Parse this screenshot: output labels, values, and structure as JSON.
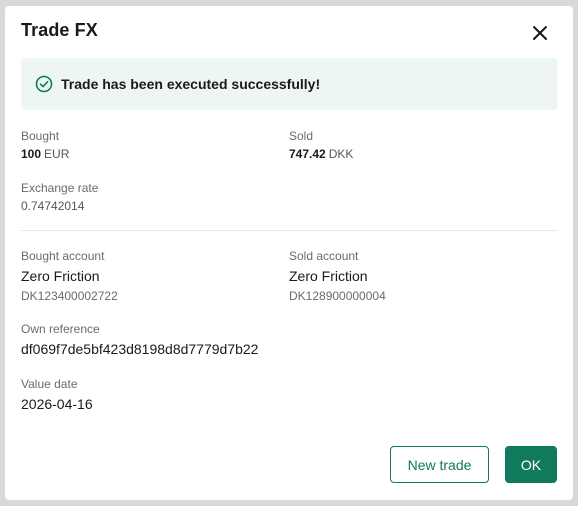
{
  "dialog": {
    "title": "Trade FX",
    "close_icon": "close-icon"
  },
  "alert": {
    "icon": "check-circle-icon",
    "message": "Trade has been executed successfully!",
    "accent": "#0f7a5c",
    "background": "#eef6f4"
  },
  "trade": {
    "bought_label": "Bought",
    "bought_amount": "100",
    "bought_currency": "EUR",
    "sold_label": "Sold",
    "sold_amount": "747.42",
    "sold_currency": "DKK",
    "rate_label": "Exchange rate",
    "rate_value": "0.74742014"
  },
  "accounts": {
    "bought_account_label": "Bought account",
    "bought_account_name": "Zero Friction",
    "bought_account_number": "DK123400002722",
    "sold_account_label": "Sold account",
    "sold_account_name": "Zero Friction",
    "sold_account_number": "DK128900000004",
    "own_reference_label": "Own reference",
    "own_reference_value": "df069f7de5bf423d8198d8d7779d7b22",
    "value_date_label": "Value date",
    "value_date_value": "2026-04-16"
  },
  "actions": {
    "new_trade_label": "New trade",
    "ok_label": "OK"
  },
  "colors": {
    "brand": "#0f7a5c"
  }
}
